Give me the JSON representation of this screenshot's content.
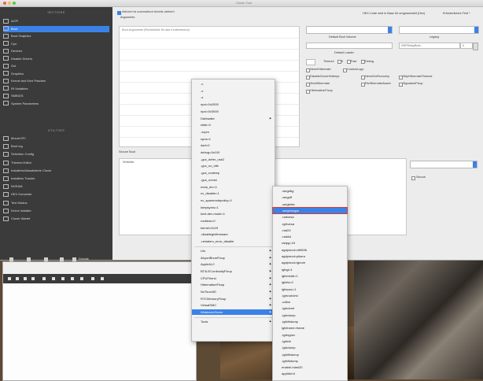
{
  "window": {
    "title": "Clover Tool"
  },
  "sidebar": {
    "section1": "SECTIONS",
    "items": [
      "ACPI",
      "Boot",
      "Boot Graphics",
      "Cpu",
      "Devices",
      "Disable Drivers",
      "Gui",
      "Graphics",
      "Kernel and Kext Patches",
      "Rt Variables",
      "SMBIOS",
      "System Parameters"
    ],
    "selected_index": 1,
    "section2": "UTILITIES",
    "tools": [
      "Mount EFI",
      "Boot log",
      "Selection Config",
      "Themes Editor",
      "Installers/Aktualisierte Clover",
      "Installers Tracker",
      "NVRAM",
      "HEX Konverter",
      "Text Modus",
      "Kerne Installer",
      "Clover Wartet"
    ],
    "donate_label": "Donate"
  },
  "boot": {
    "hint_checkbox": "Aktiviert ist automatisch Arbeits aktiviert",
    "arguments_label": "Arguments",
    "hex_hint": "HEX-Code wird in Base 64 umgewandelt (Hex)",
    "required_hint": "Erforderliches Feld *",
    "arguments_placeholder": "Boot Arguments (Rechtsklick für das Kontextmenü)",
    "default_volume_label": "Default Boot Volume",
    "legacy_label": "Legacy",
    "legacy_value": "XMPDelayBoot...",
    "legacy_stepper": "0",
    "default_loader_label": "Default Loader",
    "timeout_label": "Timeout",
    "timeout_value": "5",
    "fast_label": "Fast",
    "debug_label": "Debug",
    "options": [
      "NeverHibernate",
      "CustomLogo",
      "DisableCloverHotkeys",
      "NeverDoRecovery",
      "SkipHibernateTimeout",
      "StrictHibernate",
      "RtcHibernateAware",
      "SignatureFixup",
      "HibernationFixup"
    ],
    "secure_boot_label": "Secure Boot",
    "whitelist_label": "Whitelist",
    "secure_label": "Secure"
  },
  "context_menu": {
    "items": [
      "-v",
      "-x",
      "-s",
      "npci=0x2000",
      "npci=0x3000",
      "Darkwake",
      "slide=0",
      "-xcpm",
      "cpus=1",
      "dart=0",
      "debug=0x100",
      "-gux_defer_usb2",
      "-gux_no_idle",
      "-gux_nosleep",
      "-gux_nomsi",
      "nvda_drv=1",
      "nv_disable=1",
      "nv_spanmodepolicy=1",
      "keepsyms=1",
      "kext-dev-mode=1",
      "rootless=0",
      "kernel=0x1ff",
      "-disablegfxfirmware",
      "-nehalem_error_disable",
      "Lilu",
      "AirportBrcmFixup",
      "AppleALC",
      "BT4LEContinuityFixup",
      "CPUFriend",
      "HibernationFixup",
      "NoTouchID",
      "RTCMemoryFixup",
      "VirtualSMC",
      "WhateverGreen",
      "Tools"
    ],
    "submenu_arrows": [
      5,
      24,
      25,
      26,
      27,
      28,
      29,
      30,
      31,
      32,
      33,
      34
    ],
    "highlighted_index": 33,
    "separator_after": [
      23,
      33
    ]
  },
  "submenu": {
    "items": [
      "-wegdbg",
      "-wegoff",
      "-wegbeta",
      "-wegnoegpu",
      "-radvesa",
      "-igfxvesa",
      "-rad24",
      "-raddvi",
      "radpg=15",
      "agdpmod=vit9696",
      "agdpmod=pikera",
      "agdpmod=ignore",
      "igfxgl=1",
      "igfxmetal=1",
      "igfxfw=2",
      "igfxrpsc=1",
      "-igfxnohdmi",
      "-cdfon",
      "-igfxdvmt",
      "-igfxdump",
      "-igfxfbdump",
      "igfxframe=frame",
      "-igfxtypec",
      "-igfxblr",
      "-igfxdump",
      "-igfxlfbdump",
      "-igfxfbdump",
      "enable-hdmi20",
      "applbkl=0"
    ],
    "highlighted_index": 3
  }
}
